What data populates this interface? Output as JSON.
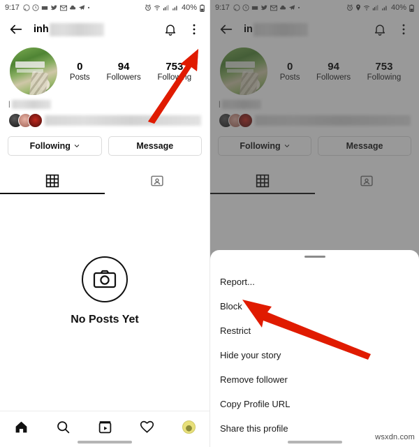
{
  "status_bar": {
    "time": "9:17",
    "battery_text": "40%",
    "left_icons": [
      "whatsapp-icon",
      "clock-icon",
      "mail-icon",
      "twitter-icon",
      "gmail-icon",
      "cloud-icon",
      "telegram-icon",
      "dot-icon"
    ],
    "right_icons": [
      "alarm-icon",
      "location-icon",
      "wifi-icon",
      "signal-icon",
      "cellular-icon",
      "battery-icon"
    ]
  },
  "app_bar": {
    "back_icon": "back-arrow-icon",
    "username_visible": "inh",
    "username_visible_right": "in",
    "bell_icon": "bell-icon",
    "overflow_icon": "more-vertical-icon"
  },
  "profile": {
    "avatar": "profile-photo",
    "stats": [
      {
        "num": "0",
        "label": "Posts"
      },
      {
        "num": "94",
        "label": "Followers"
      },
      {
        "num": "753",
        "label": "Following"
      }
    ],
    "following_num_left_partial": "753"
  },
  "actions": {
    "following_label": "Following",
    "message_label": "Message"
  },
  "tabs": [
    {
      "name": "grid-tab",
      "icon": "grid-icon",
      "active": true
    },
    {
      "name": "tagged-tab",
      "icon": "tagged-person-icon",
      "active": false
    }
  ],
  "empty_state": {
    "icon": "camera-icon",
    "label": "No Posts Yet"
  },
  "bottom_nav": [
    {
      "name": "home",
      "icon": "home-icon"
    },
    {
      "name": "search",
      "icon": "search-icon"
    },
    {
      "name": "reels",
      "icon": "reels-icon"
    },
    {
      "name": "activity",
      "icon": "heart-icon"
    },
    {
      "name": "profile",
      "icon": "avatar-icon"
    }
  ],
  "sheet": {
    "handle": "drag-handle",
    "items": [
      "Report...",
      "Block",
      "Restrict",
      "Hide your story",
      "Remove follower",
      "Copy Profile URL",
      "Share this profile"
    ]
  },
  "annotations": {
    "arrow_color": "#e01b00",
    "left_arrow_target": "more-vertical-icon",
    "right_arrow_target": "Block"
  },
  "watermark": "wsxdn.com"
}
